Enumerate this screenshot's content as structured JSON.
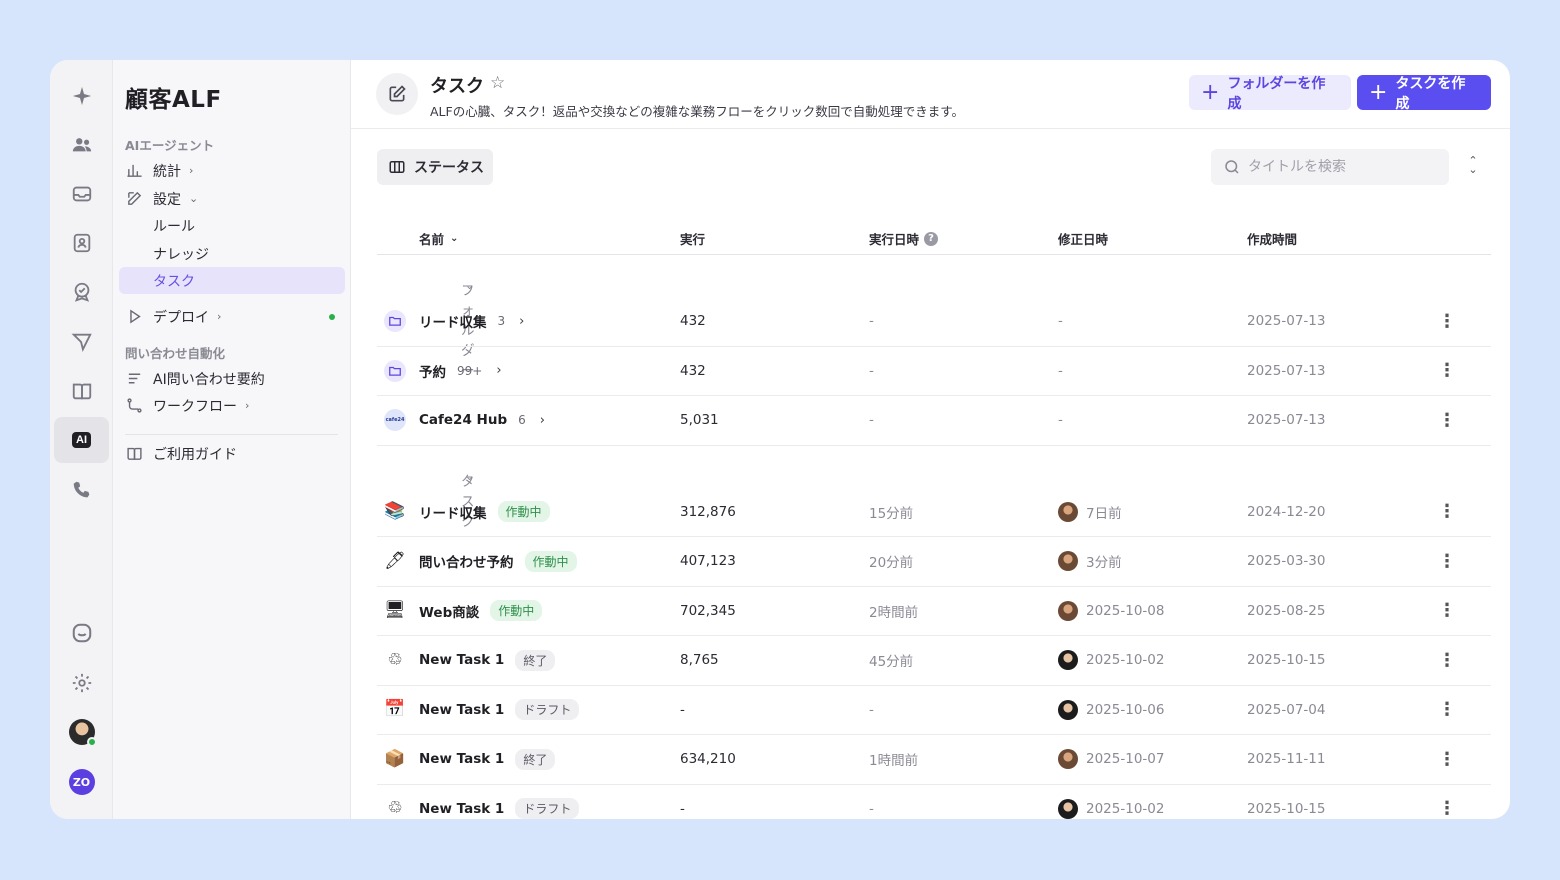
{
  "workspace": {
    "title": "顧客ALF"
  },
  "sidebar": {
    "section_agent": "AIエージェント",
    "items": [
      {
        "label": "統計",
        "chevron": ">"
      },
      {
        "label": "設定",
        "chevron": "v"
      },
      {
        "label": "ルール"
      },
      {
        "label": "ナレッジ"
      },
      {
        "label": "タスク"
      },
      {
        "label": "デプロイ",
        "chevron": ">"
      }
    ],
    "section_inquiry": "問い合わせ自動化",
    "inquiry_items": [
      {
        "label": "AI問い合わせ要約"
      },
      {
        "label": "ワークフロー",
        "chevron": ">"
      }
    ],
    "guide": "ご利用ガイド"
  },
  "rail": {
    "ai_label": "AI",
    "zo_label": "ZO"
  },
  "header": {
    "title": "タスク",
    "description": "ALFの心臓、タスク！返品や交換などの複雑な業務フローをクリック数回で自動処理できます。",
    "btn_folder": "フォルダーを作成",
    "btn_task": "タスクを作成"
  },
  "toolbar": {
    "status_label": "ステータス",
    "search_placeholder": "タイトルを検索"
  },
  "table": {
    "columns": {
      "name": "名前",
      "exec": "実行",
      "run_at": "実行日時",
      "modified": "修正日時",
      "created": "作成時間"
    },
    "folder_group": "フォルダー",
    "task_group": "タスク",
    "folders": [
      {
        "icon": "folder",
        "name": "リード収集",
        "count": "3",
        "exec": "432",
        "run_at": "-",
        "modified": "-",
        "created": "2025-07-13"
      },
      {
        "icon": "folder",
        "name": "予約",
        "count": "99+",
        "exec": "432",
        "run_at": "-",
        "modified": "-",
        "created": "2025-07-13"
      },
      {
        "icon": "cafe24",
        "name": "Cafe24 Hub",
        "count": "6",
        "exec": "5,031",
        "run_at": "-",
        "modified": "-",
        "created": "2025-07-13"
      }
    ],
    "tasks": [
      {
        "icon": "📚",
        "name": "リード収集",
        "status": "作動中",
        "status_kind": "active",
        "exec": "312,876",
        "run_at": "15分前",
        "modified": "7日前",
        "avatar": "a1",
        "created": "2024-12-20"
      },
      {
        "icon": "🖊",
        "name": "問い合わせ予約",
        "status": "作動中",
        "status_kind": "active",
        "exec": "407,123",
        "run_at": "20分前",
        "modified": "3分前",
        "avatar": "a1",
        "created": "2025-03-30"
      },
      {
        "icon": "🖥",
        "name": "Web商談",
        "status": "作動中",
        "status_kind": "active",
        "exec": "702,345",
        "run_at": "2時間前",
        "modified": "2025-10-08",
        "avatar": "a1",
        "created": "2025-08-25"
      },
      {
        "icon": "♲",
        "name": "New Task 1",
        "status": "終了",
        "status_kind": "done",
        "exec": "8,765",
        "run_at": "45分前",
        "modified": "2025-10-02",
        "avatar": "a2",
        "created": "2025-10-15"
      },
      {
        "icon": "📅",
        "name": "New Task 1",
        "status": "ドラフト",
        "status_kind": "draft",
        "exec": "-",
        "run_at": "-",
        "modified": "2025-10-06",
        "avatar": "a2",
        "created": "2025-07-04"
      },
      {
        "icon": "📦",
        "name": "New Task 1",
        "status": "終了",
        "status_kind": "done",
        "exec": "634,210",
        "run_at": "1時間前",
        "modified": "2025-10-07",
        "avatar": "a1",
        "created": "2025-11-11"
      },
      {
        "icon": "♲",
        "name": "New Task 1",
        "status": "ドラフト",
        "status_kind": "draft",
        "exec": "-",
        "run_at": "-",
        "modified": "2025-10-02",
        "avatar": "a2",
        "created": "2025-10-15"
      }
    ]
  },
  "colors": {
    "accent": "#5b4ef0",
    "active_green": "#2f8f4b",
    "background": "#d6e4fc"
  }
}
